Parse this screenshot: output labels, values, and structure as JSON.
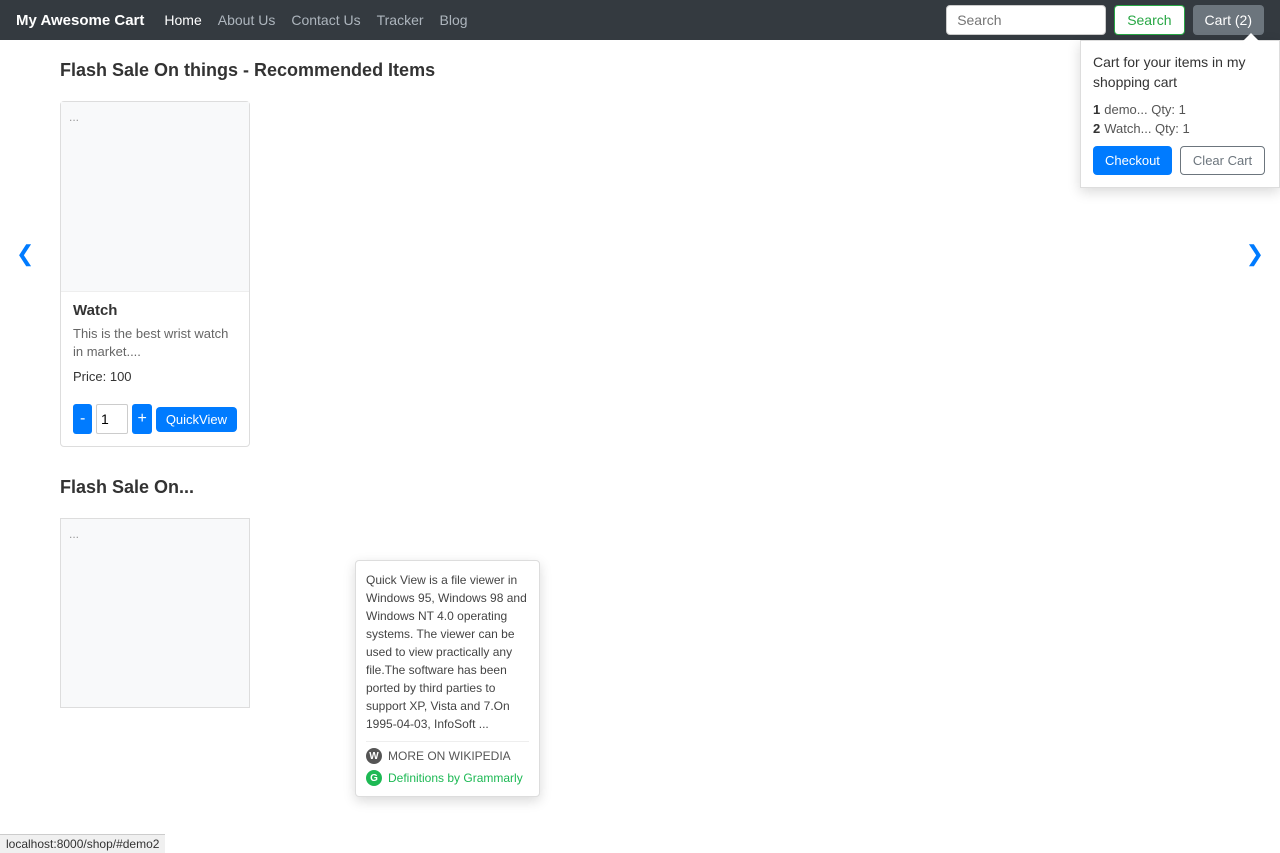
{
  "navbar": {
    "brand": "My Awesome Cart",
    "links": [
      {
        "label": "Home",
        "active": true
      },
      {
        "label": "About Us",
        "active": false
      },
      {
        "label": "Contact Us",
        "active": false
      },
      {
        "label": "Tracker",
        "active": false
      },
      {
        "label": "Blog",
        "active": false
      }
    ],
    "search_placeholder": "Search",
    "search_btn_label": "Search",
    "cart_label": "Cart (2)"
  },
  "cart_dropdown": {
    "title": "Cart for your items in my shopping cart",
    "items": [
      {
        "num": "1",
        "text": "demo... Qty: 1"
      },
      {
        "num": "2",
        "text": "Watch... Qty: 1"
      }
    ],
    "checkout_label": "Checkout",
    "clear_label": "Clear Cart"
  },
  "section1": {
    "title": "Flash Sale On things - Recommended Items",
    "carousel_left": "❮",
    "carousel_right": "❯"
  },
  "product": {
    "name": "Watch",
    "description": "This is the best wrist watch in market....",
    "price": "Price: 100",
    "qty": "1",
    "minus_label": "-",
    "plus_label": "+",
    "quickview_label": "QuickView"
  },
  "tooltip": {
    "text": "Quick View is a file viewer in Windows 95, Windows 98 and Windows NT 4.0 operating systems. The viewer can be used to view practically any file.The software has been ported by third parties to support XP, Vista and 7.On 1995-04-03, InfoSoft ...",
    "wikipedia_label": "MORE ON WIKIPEDIA",
    "grammarly_label": "Definitions by Grammarly"
  },
  "section2": {
    "title": "Flash Sale On..."
  },
  "statusbar": {
    "url": "localhost:8000/shop/#demo2"
  }
}
